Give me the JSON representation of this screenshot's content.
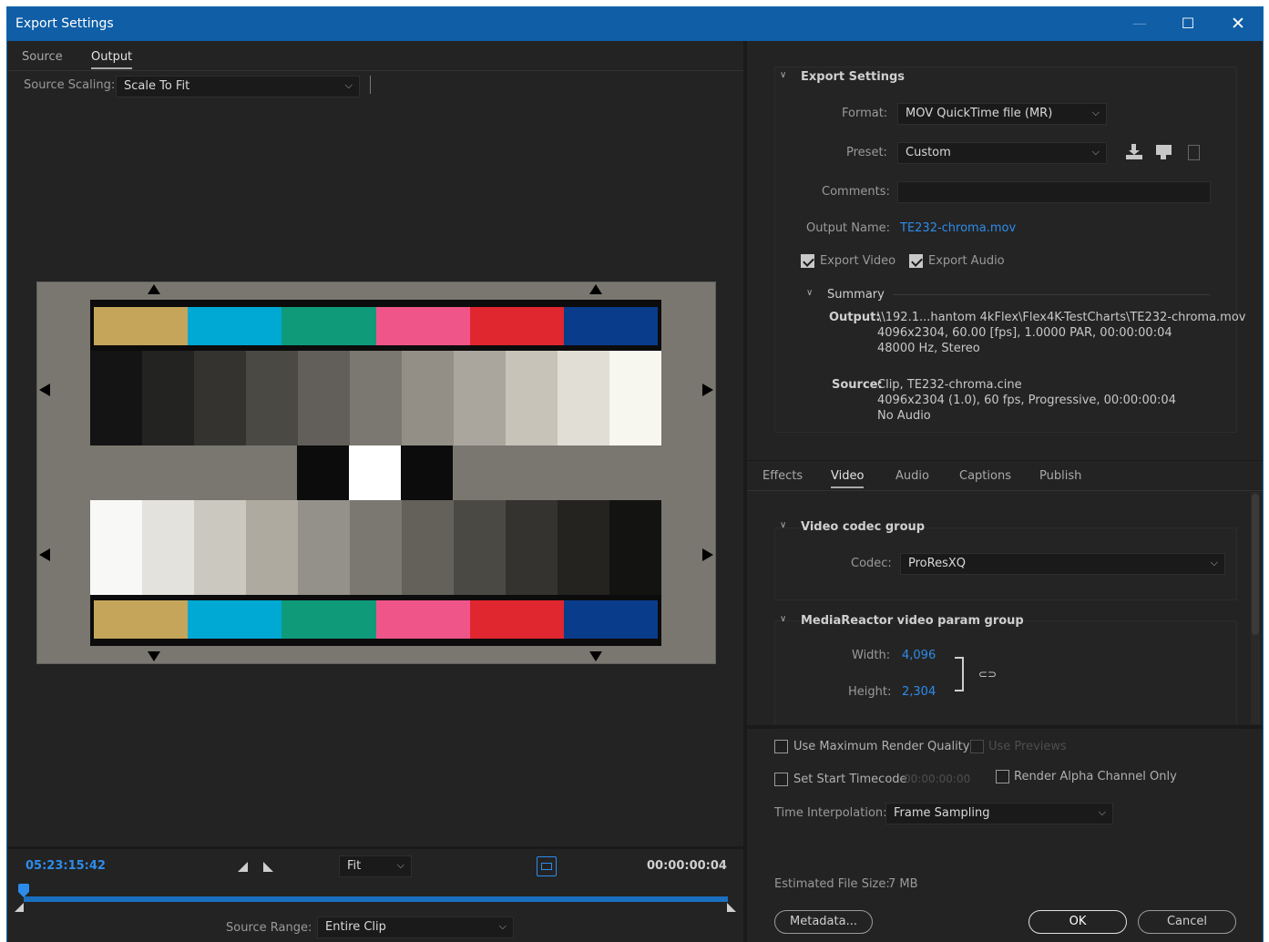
{
  "window": {
    "title": "Export Settings"
  },
  "left_tabs": [
    {
      "label": "Source"
    },
    {
      "label": "Output"
    }
  ],
  "source_scaling": {
    "label": "Source Scaling:",
    "value": "Scale To Fit"
  },
  "chart": {
    "color_bars": [
      "#c4a55a",
      "#00a8d4",
      "#0f9a7a",
      "#f0558a",
      "#e0262f",
      "#0a3c8c"
    ],
    "gray_top": [
      "#141414",
      "#232321",
      "#34332f",
      "#4a4944",
      "#625f5a",
      "#7b7871",
      "#938f87",
      "#aba69d",
      "#c7c3b8",
      "#e1ded5",
      "#f7f6ef"
    ],
    "gray_bottom": [
      "#f8f8f6",
      "#e4e2dc",
      "#cbc8c0",
      "#aeaaa0",
      "#94918a",
      "#7b7871",
      "#64615b",
      "#4b4944",
      "#35332f",
      "#242320",
      "#131311"
    ],
    "mid": [
      "#0c0c0c",
      "#ffffff",
      "#0c0c0c"
    ]
  },
  "timeline": {
    "current": "05:23:15:42",
    "zoom": "Fit",
    "duration": "00:00:00:04",
    "source_range_label": "Source Range:",
    "source_range": "Entire Clip"
  },
  "export_settings": {
    "title": "Export Settings",
    "format_label": "Format:",
    "format": "MOV QuickTime file (MR)",
    "preset_label": "Preset:",
    "preset": "Custom",
    "comments_label": "Comments:",
    "comments": "",
    "output_name_label": "Output Name:",
    "output_name": "TE232-chroma.mov",
    "export_video": "Export Video",
    "export_audio": "Export Audio"
  },
  "summary": {
    "title": "Summary",
    "output_label": "Output:",
    "output_lines": [
      "\\\\192.1...hantom 4kFlex\\Flex4K-TestCharts\\TE232-chroma.mov",
      "4096x2304, 60.00 [fps], 1.0000 PAR, 00:00:00:04",
      "48000 Hz, Stereo"
    ],
    "source_label": "Source:",
    "source_lines": [
      "Clip, TE232-chroma.cine",
      "4096x2304 (1.0), 60 fps, Progressive, 00:00:00:04",
      "No Audio"
    ]
  },
  "right_tabs": [
    {
      "label": "Effects"
    },
    {
      "label": "Video"
    },
    {
      "label": "Audio"
    },
    {
      "label": "Captions"
    },
    {
      "label": "Publish"
    }
  ],
  "video": {
    "codec_group": "Video codec group",
    "codec_label": "Codec:",
    "codec": "ProResXQ",
    "param_group": "MediaReactor video param group",
    "width_label": "Width:",
    "width": "4,096",
    "height_label": "Height:",
    "height": "2,304"
  },
  "options": {
    "max_render": "Use Maximum Render Quality",
    "use_previews": "Use Previews",
    "start_tc": "Set Start Timecode",
    "start_tc_value": "00:00:00:00",
    "alpha_only": "Render Alpha Channel Only",
    "interp_label": "Time Interpolation:",
    "interp": "Frame Sampling",
    "file_size_label": "Estimated File Size:",
    "file_size": "7 MB"
  },
  "buttons": {
    "metadata": "Metadata...",
    "ok": "OK",
    "cancel": "Cancel"
  }
}
